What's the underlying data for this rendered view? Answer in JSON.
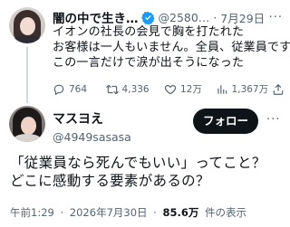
{
  "quoted_tweet": {
    "display_name": "闇の中で生き…",
    "handle": "@2580…",
    "separator": "·",
    "date": "7月29日",
    "text_lines": [
      "イオンの社長の会見で胸を打たれた",
      "お客様は一人もいません。全員、従業員です",
      "この一言だけで涙が出そうになった"
    ],
    "replies": "764",
    "reposts": "4,336",
    "likes": "12万",
    "views": "1,367万"
  },
  "main_tweet": {
    "display_name": "マスヨえ",
    "handle": "@4949sasasa",
    "follow_label": "フォロー",
    "text_lines": [
      "「従業員なら死んでもいい」ってこと？",
      "どこに感動する要素があるの？"
    ],
    "time": "午前1:29",
    "separator": "·",
    "date": "2026年7月30日",
    "views_count": "85.6万",
    "views_label": "件の表示"
  },
  "colors": {
    "verified": "#1d9bf0",
    "text": "#0f1419",
    "muted": "#536471"
  }
}
